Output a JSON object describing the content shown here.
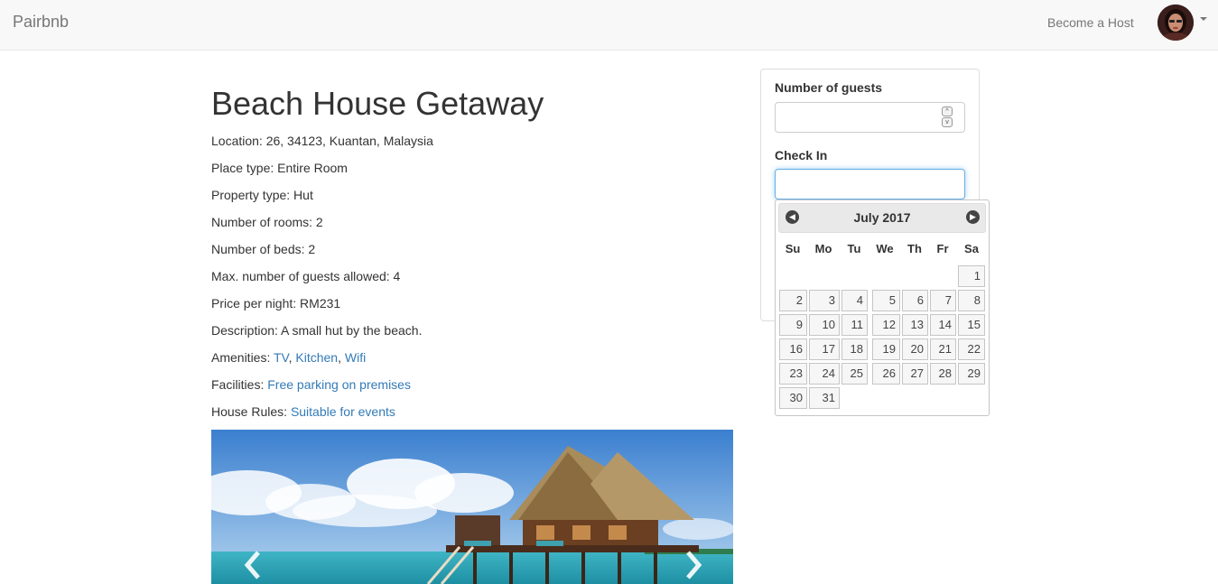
{
  "navbar": {
    "brand": "Pairbnb",
    "become_host": "Become a Host"
  },
  "listing": {
    "title": "Beach House Getaway",
    "location": "Location: 26, 34123, Kuantan, Malaysia",
    "place_type": "Place type: Entire Room",
    "property_type": "Property type: Hut",
    "rooms": "Number of rooms: 2",
    "beds": "Number of beds: 2",
    "max_guests": "Max. number of guests allowed: 4",
    "price": "Price per night: RM231",
    "description": "Description: A small hut by the beach.",
    "amenities_label": "Amenities: ",
    "amenities": [
      "TV",
      "Kitchen",
      "Wifi"
    ],
    "facilities_label": "Facilities: ",
    "facilities": "Free parking on premises",
    "rules_label": "House Rules: ",
    "rules": "Suitable for events"
  },
  "booking": {
    "guests_label": "Number of guests",
    "guests_value": "",
    "checkin_label": "Check In",
    "checkin_value": ""
  },
  "datepicker": {
    "month": "July 2017",
    "weekdays": [
      "Su",
      "Mo",
      "Tu",
      "We",
      "Th",
      "Fr",
      "Sa"
    ],
    "days": [
      "1",
      "2",
      "3",
      "4",
      "5",
      "6",
      "7",
      "8",
      "9",
      "10",
      "11",
      "12",
      "13",
      "14",
      "15",
      "16",
      "17",
      "18",
      "19",
      "20",
      "21",
      "22",
      "23",
      "24",
      "25",
      "26",
      "27",
      "28",
      "29",
      "30",
      "31"
    ]
  },
  "colors": {
    "link": "#337ab7",
    "navbar_bg": "#f8f8f8",
    "focus_border": "#66afe9"
  },
  "icons": {
    "prev_month": "chevron-left-icon",
    "next_month": "chevron-right-icon",
    "carousel_prev": "chevron-left-icon",
    "carousel_next": "chevron-right-icon"
  }
}
